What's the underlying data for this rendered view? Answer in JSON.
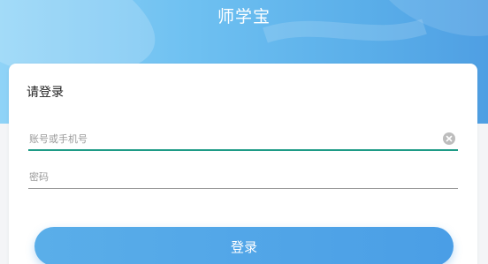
{
  "app": {
    "title": "师学宝"
  },
  "login": {
    "heading": "请登录",
    "account": {
      "value": "",
      "placeholder": "账号或手机号"
    },
    "password": {
      "value": "",
      "placeholder": "密码"
    },
    "submit_label": "登录"
  },
  "icons": {
    "clear": "clear-icon"
  },
  "colors": {
    "header_start": "#8fd3f7",
    "header_end": "#4f9fe3",
    "accent_underline": "#1e9b86",
    "button": "#4a9ee6"
  }
}
